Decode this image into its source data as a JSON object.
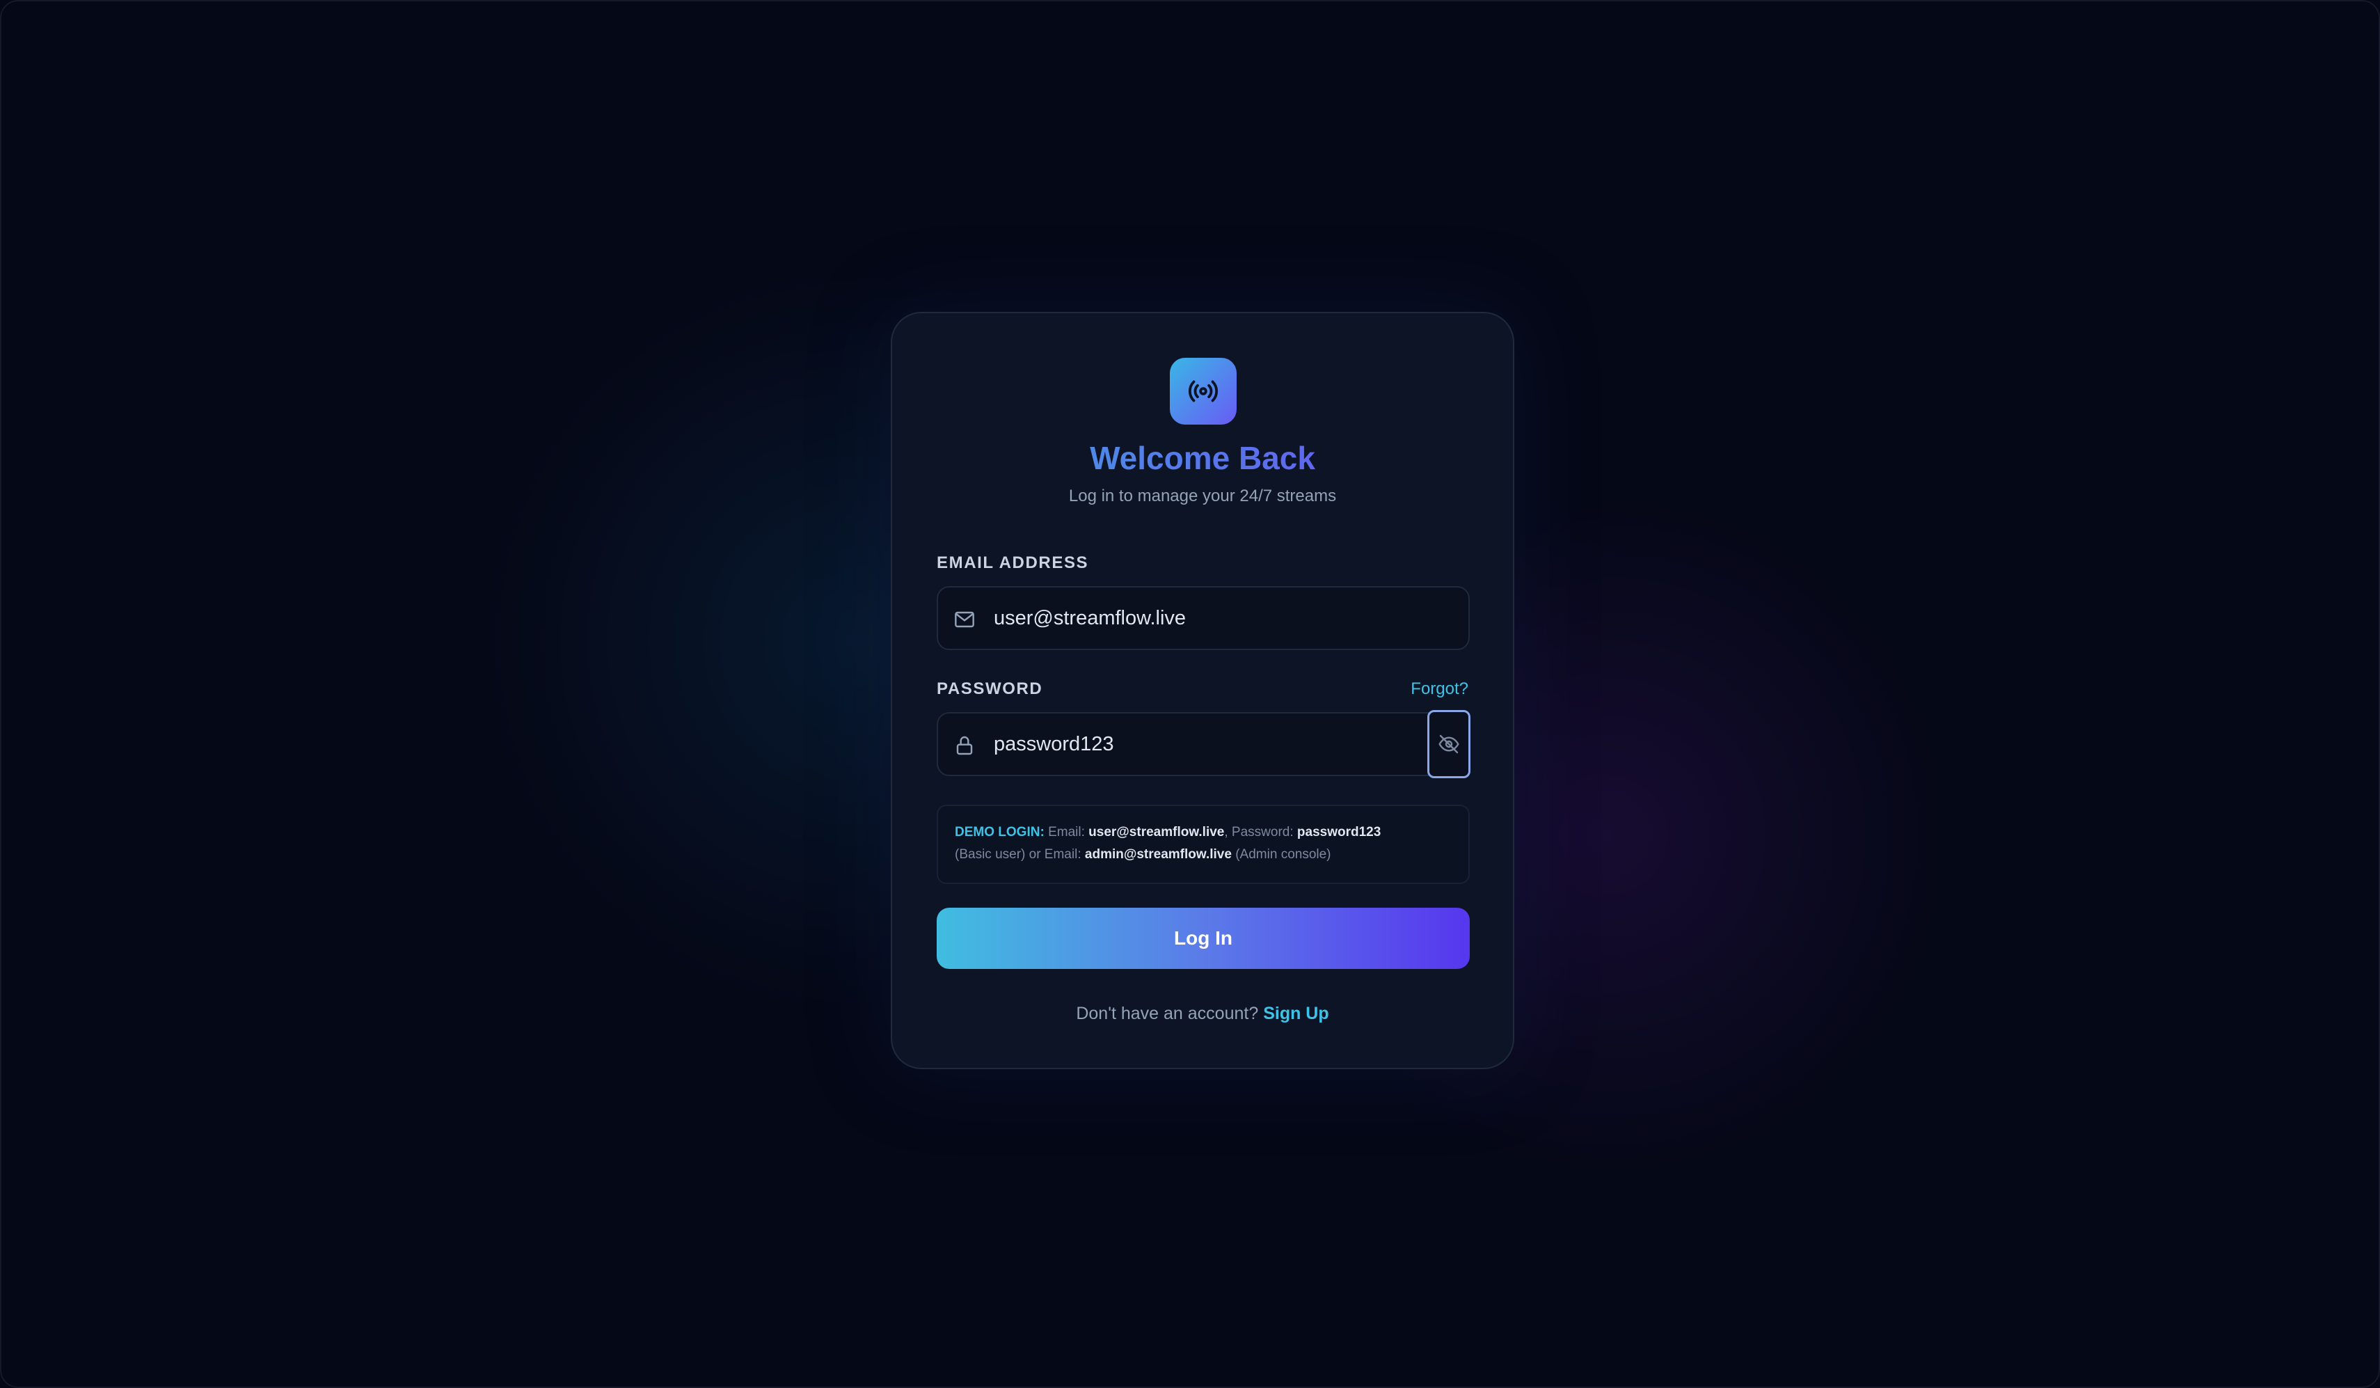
{
  "login": {
    "title": "Welcome Back",
    "subtitle": "Log in to manage your 24/7 streams",
    "logo_icon": "broadcast-icon",
    "email": {
      "label": "EMAIL ADDRESS",
      "value": "user@streamflow.live",
      "icon": "mail-icon"
    },
    "password": {
      "label": "PASSWORD",
      "value": "password123",
      "icon": "lock-icon",
      "forgot_label": "Forgot?",
      "toggle_icon": "eye-off-icon"
    },
    "demo": {
      "tag": "DEMO LOGIN:",
      "email_prefix": "Email:",
      "user_email": "user@streamflow.live",
      "password_prefix": ", Password:",
      "user_password": "password123",
      "basic_note": "(Basic user) or Email:",
      "admin_email": "admin@streamflow.live",
      "admin_note": "(Admin console)"
    },
    "submit_label": "Log In",
    "footer_text": "Don't have an account?",
    "signup_label": "Sign Up"
  },
  "colors": {
    "background": "#050817",
    "card": "#0d1425",
    "accent_cyan": "#3ec3e8",
    "accent_violet": "#5637ee"
  }
}
